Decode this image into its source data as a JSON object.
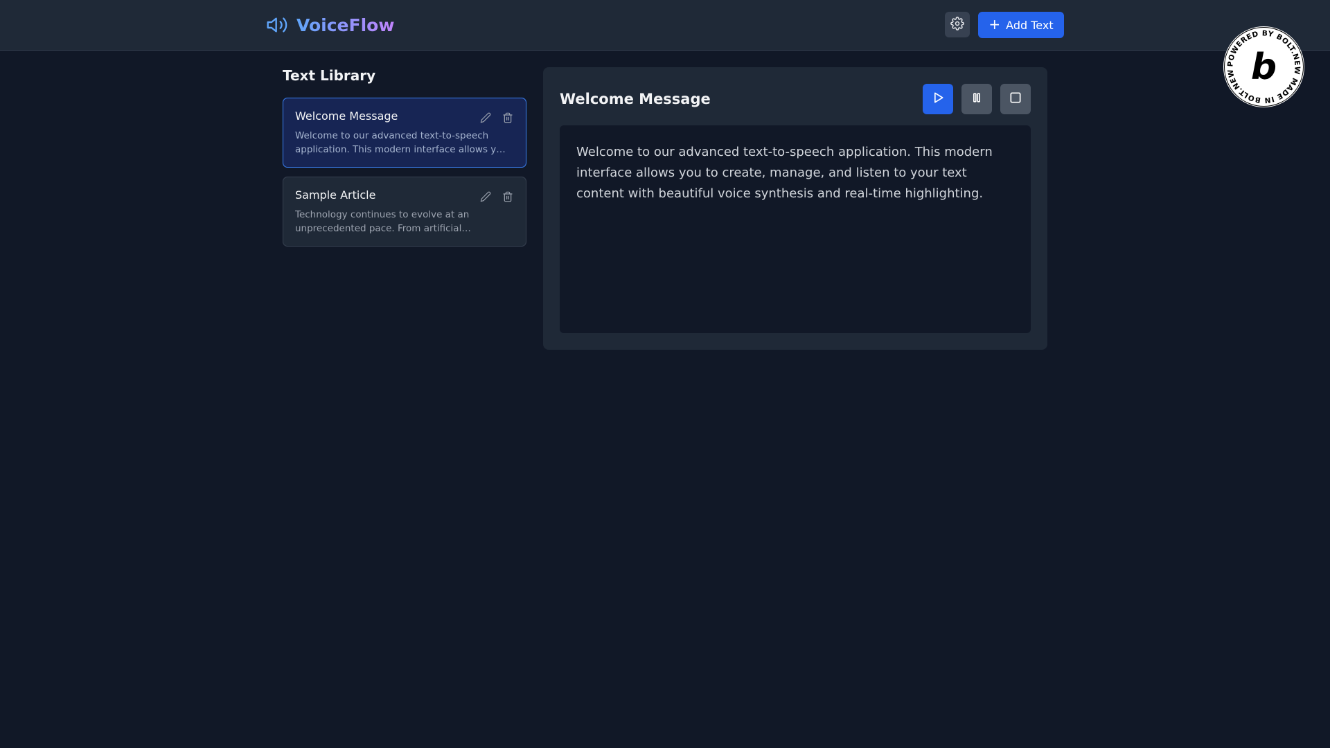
{
  "header": {
    "app_name": "VoiceFlow",
    "logo_icon": "speaker-icon",
    "settings_icon": "gear-icon",
    "add_button_label": "Add Text"
  },
  "library": {
    "title": "Text Library",
    "items": [
      {
        "title": "Welcome Message",
        "preview": "Welcome to our advanced text-to-speech application. This modern interface allows you to create, manage, and listen to your text content with beautiful voice synthesis and real-time highlighting.",
        "active": true
      },
      {
        "title": "Sample Article",
        "preview": "Technology continues to evolve at an unprecedented pace. From artificial intelligence to quantum computing...",
        "active": false
      }
    ]
  },
  "player": {
    "title": "Welcome Message",
    "content": "Welcome to our advanced text-to-speech application. This modern interface allows you to create, manage, and listen to your text content with beautiful voice synthesis and real-time highlighting.",
    "controls": [
      "play-icon",
      "pause-icon",
      "stop-icon"
    ]
  },
  "badge": {
    "ring_text": "POWERED BY BOLT.NEW MADE IN BOLT.NEW ",
    "letter": "b"
  },
  "colors": {
    "background": "#111827",
    "panel": "#1f2937",
    "accent": "#2563eb",
    "active_card": "#172554"
  }
}
